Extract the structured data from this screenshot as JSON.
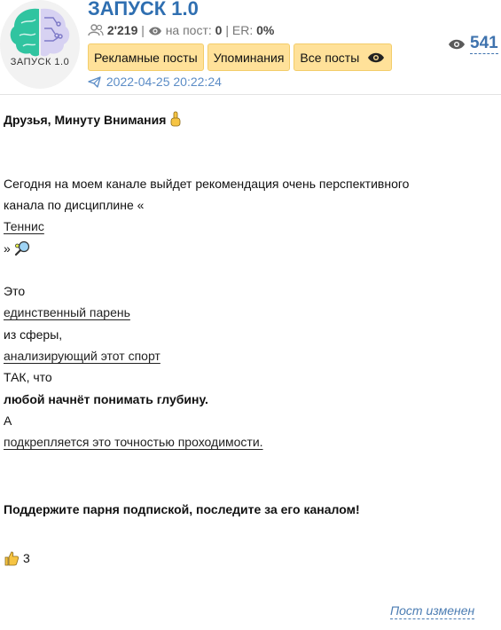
{
  "channel": {
    "title": "ЗАПУСК 1.0",
    "logo_text": "ЗАПУСК 1.0",
    "subscribers": "2'219",
    "per_post_label": "на пост:",
    "per_post_value": "0",
    "er_label": "ER:",
    "er_value": "0%",
    "separator": "|"
  },
  "buttons": {
    "ads": "Рекламные посты",
    "mentions": "Упоминания",
    "all": "Все посты"
  },
  "post": {
    "date": "2022-04-25 20:22:24",
    "views": "541",
    "heading": "Друзья, Минуту Внимания",
    "p1_line1": "Сегодня на моем канале выйдет рекомендация очень перспективного",
    "p1_line2": "канала по дисциплине «",
    "tennis_link": "Теннис",
    "closing_quote": "»",
    "w_this": "Это",
    "link_only_guy": "единственный парень",
    "w_from_sphere": "из сферы,",
    "link_analyzing": "анализирующий этот спорт",
    "w_so_that": "ТАК, что",
    "bold_depth": "любой начнёт понимать глубину.",
    "w_a": "А",
    "link_accuracy": "подкрепляется это точностью проходимости.",
    "cta": "Поддержите парня подпиской, последите за его каналом!",
    "reaction_count": "3",
    "edited_label": "Пост изменен"
  },
  "colors": {
    "accent": "#2f6fb1",
    "button_bg": "#ffe199"
  },
  "icons": [
    "users-icon",
    "eye-icon",
    "telegram-icon",
    "pointing-up-emoji",
    "tennis-racket-emoji",
    "thumbs-up-emoji"
  ]
}
